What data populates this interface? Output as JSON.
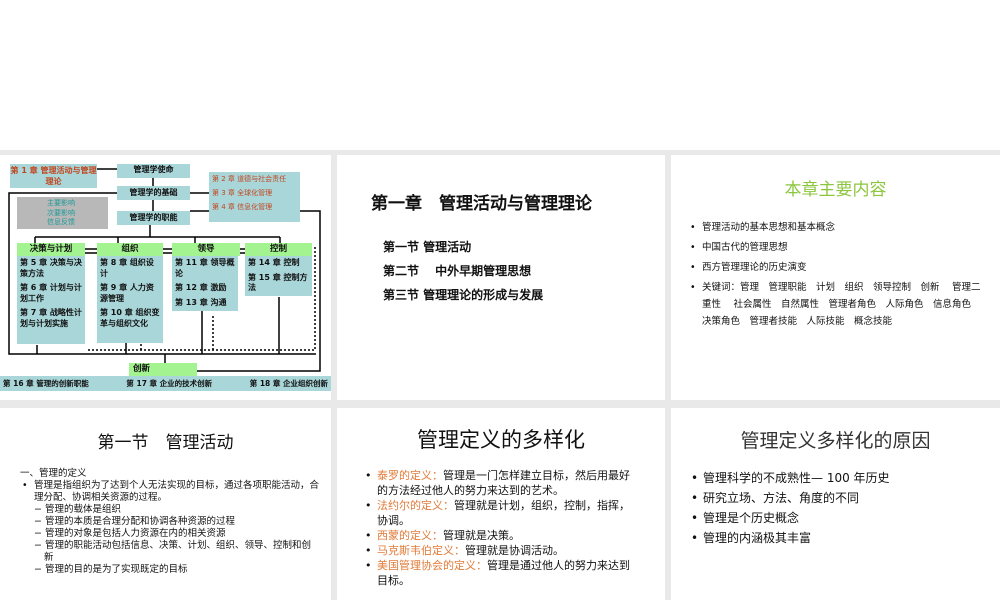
{
  "slide1": {
    "ch1": "第 1 章  管理活动与管理理论",
    "mission": "管理学使命",
    "foundation": "管理学的基础",
    "functions": "管理学的职能",
    "legend": [
      "主要影响",
      "次要影响",
      "信息反馈"
    ],
    "ch2": "第 2 章  道德与社会责任",
    "ch3": "第 3 章  全球化管理",
    "ch4": "第 4 章  信息化管理",
    "columns": [
      {
        "title": "决策与计划",
        "items": [
          "第 5 章  决策与决策方法",
          "第 6 章  计划与计划工作",
          "第 7 章  战略性计划与计划实施"
        ]
      },
      {
        "title": "组织",
        "items": [
          "第 8 章  组织设计",
          "第 9 章  人力资源管理",
          "第 10 章  组织变革与组织文化"
        ]
      },
      {
        "title": "领导",
        "items": [
          "第 11 章  领导概论",
          "第 12 章  激励",
          "第 13 章  沟通"
        ]
      },
      {
        "title": "控制",
        "items": [
          "第 14 章  控制",
          "第 15 章  控制方法"
        ]
      }
    ],
    "innovation": "创新",
    "bottom": [
      "第 16 章  管理的创新职能",
      "第 17 章  企业的技术创新",
      "第 18 章  企业组织创新"
    ]
  },
  "slide2": {
    "title": "第一章　管理活动与管理理论",
    "sections": [
      "第一节 管理活动",
      "第二节　 中外早期管理思想",
      "第三节 管理理论的形成与发展"
    ]
  },
  "slide3": {
    "title": "本章主要内容",
    "items": [
      "管理活动的基本思想和基本概念",
      "中国古代的管理思想",
      "西方管理理论的历史演变",
      "关键词：管理　管理职能　计划　组织　领导控制　创新　 管理二重性　 社会属性　自然属性　管理者角色　人际角色　信息角色　决策角色　管理者技能　人际技能　概念技能"
    ]
  },
  "slide4": {
    "title": "第一节　管理活动",
    "heading": "一、管理的定义",
    "bullet": "管理是指组织为了达到个人无法实现的目标，通过各项职能活动，合理分配、协调相关资源的过程。",
    "subs": [
      "管理的载体是组织",
      "管理的本质是合理分配和协调各种资源的过程",
      "管理的对象是包括人力资源在内的相关资源",
      "管理的职能活动包括信息、决策、计划、组织、领导、控制和创新",
      "管理的目的是为了实现既定的目标"
    ]
  },
  "slide5": {
    "title": "管理定义的多样化",
    "items": [
      {
        "label": "泰罗的定义：",
        "text": "管理是一门怎样建立目标，然后用最好的方法经过他人的努力来达到的艺术。"
      },
      {
        "label": "法约尔的定义：",
        "text": "管理就是计划，组织，控制，指挥，协调。"
      },
      {
        "label": "西蒙的定义：",
        "text": "管理就是决策。"
      },
      {
        "label": "马克斯韦伯定义：",
        "text": "管理就是协调活动。"
      },
      {
        "label": "美国管理协会的定义：",
        "text": "管理是通过他人的努力来达到目标。"
      }
    ]
  },
  "slide6": {
    "title": "管理定义多样化的原因",
    "items": [
      "管理科学的不成熟性— 100 年历史",
      "研究立场、方法、角度的不同",
      "管理是个历史概念",
      "管理的内涵极其丰富"
    ]
  },
  "colors": {
    "teal": "#a9d6d9",
    "green": "#a3f391",
    "orange": "#e07b39",
    "title_green": "#8cc63f"
  }
}
